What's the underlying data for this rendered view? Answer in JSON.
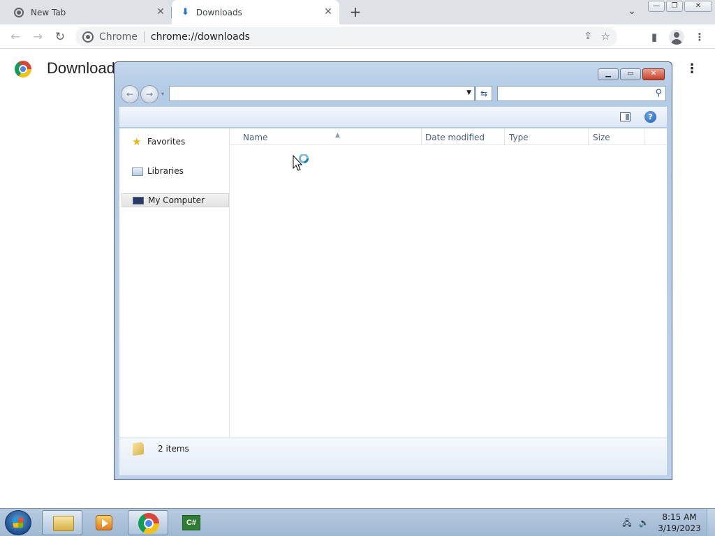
{
  "browser": {
    "tabs": [
      {
        "label": "New Tab"
      },
      {
        "label": "Downloads"
      }
    ],
    "tab_close_glyph": "✕",
    "new_tab_glyph": "+",
    "omnibox": {
      "chip": "Chrome",
      "url": "chrome://downloads"
    }
  },
  "page": {
    "title": "Downloads"
  },
  "dialog": {
    "nav_pane": {
      "items": [
        {
          "label": "Favorites",
          "icon": "star-icon"
        },
        {
          "label": "Libraries",
          "icon": "library-icon"
        },
        {
          "label": "My Computer",
          "icon": "computer-icon",
          "selected": true
        }
      ]
    },
    "columns": [
      "Name",
      "Date modified",
      "Type",
      "Size"
    ],
    "status": "2 items"
  },
  "taskbar": {
    "clock": {
      "time": "8:15 AM",
      "date": "3/19/2023"
    },
    "cs_label": "C#"
  },
  "colors": {
    "tabstrip": "#dee1e6",
    "omnibox": "#f1f3f4",
    "dialog_frame": "#b3cbe5",
    "taskbar": "#9fb8d2"
  }
}
